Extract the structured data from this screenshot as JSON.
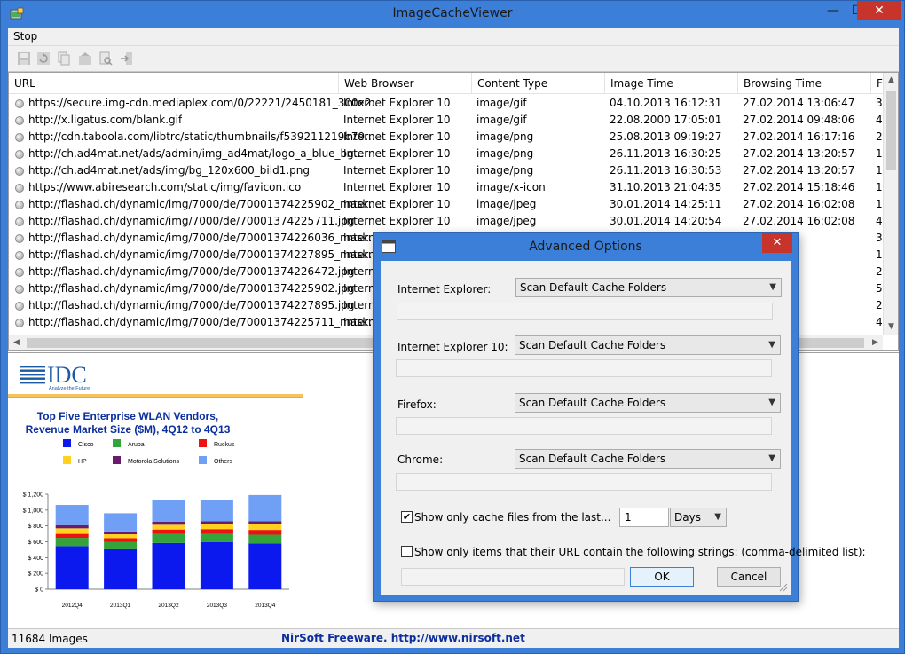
{
  "window": {
    "title": "ImageCacheViewer",
    "minimize_glyph": "—",
    "maximize_glyph": "☐",
    "close_glyph": "✕"
  },
  "menu": {
    "items": [
      "Stop"
    ]
  },
  "toolbar": {
    "icons": [
      "save-icon",
      "refresh-icon",
      "copy-icon",
      "properties-icon",
      "find-icon",
      "exit-icon"
    ]
  },
  "table": {
    "columns": [
      "URL",
      "Web Browser",
      "Content Type",
      "Image Time",
      "Browsing Time",
      "Fi"
    ],
    "rows": [
      [
        "https://secure.img-cdn.mediaplex.com/0/22221/2450181_300x2...",
        "Internet Explorer 10",
        "image/gif",
        "04.10.2013 16:12:31",
        "27.02.2014 13:06:47",
        "36"
      ],
      [
        "http://x.ligatus.com/blank.gif",
        "Internet Explorer 10",
        "image/gif",
        "22.08.2000 17:05:01",
        "27.02.2014 09:48:06",
        "43"
      ],
      [
        "http://cdn.taboola.com/libtrc/static/thumbnails/f539211219b79...",
        "Internet Explorer 10",
        "image/png",
        "25.08.2013 09:19:27",
        "27.02.2014 16:17:16",
        "25"
      ],
      [
        "http://ch.ad4mat.net/ads/admin/img_ad4mat/logo_a_blue_bg....",
        "Internet Explorer 10",
        "image/png",
        "26.11.2013 16:30:25",
        "27.02.2014 13:20:57",
        "1,"
      ],
      [
        "http://ch.ad4mat.net/ads/img/bg_120x600_bild1.png",
        "Internet Explorer 10",
        "image/png",
        "26.11.2013 16:30:53",
        "27.02.2014 13:20:57",
        "1,"
      ],
      [
        "https://www.abiresearch.com/static/img/favicon.ico",
        "Internet Explorer 10",
        "image/x-icon",
        "31.10.2013 21:04:35",
        "27.02.2014 15:18:46",
        "1,"
      ],
      [
        "http://flashad.ch/dynamic/img/7000/de/70001374225902_mask....",
        "Internet Explorer 10",
        "image/jpeg",
        "30.01.2014 14:25:11",
        "27.02.2014 16:02:08",
        "1,"
      ],
      [
        "http://flashad.ch/dynamic/img/7000/de/70001374225711.jpg",
        "Internet Explorer 10",
        "image/jpeg",
        "30.01.2014 14:20:54",
        "27.02.2014 16:02:08",
        "4,"
      ],
      [
        "http://flashad.ch/dynamic/img/7000/de/70001374226036_mask....",
        "Interne",
        "",
        "",
        "16:02:08",
        "3,"
      ],
      [
        "http://flashad.ch/dynamic/img/7000/de/70001374227895_mask....",
        "Interne",
        "",
        "",
        "16:02:08",
        "1,"
      ],
      [
        "http://flashad.ch/dynamic/img/7000/de/70001374226472.jpg",
        "Interne",
        "",
        "",
        "16:02:08",
        "2,"
      ],
      [
        "http://flashad.ch/dynamic/img/7000/de/70001374225902.jpg",
        "Interne",
        "",
        "",
        "16:02:08",
        "5,"
      ],
      [
        "http://flashad.ch/dynamic/img/7000/de/70001374227895.jpg",
        "Interne",
        "",
        "",
        "16:02:08",
        "2,"
      ],
      [
        "http://flashad.ch/dynamic/img/7000/de/70001374225711_mask....",
        "Interne",
        "",
        "",
        "16:02:08",
        "4,"
      ]
    ]
  },
  "preview": {
    "logo_text": "IDC",
    "logo_tagline": "Analyze the Future",
    "chart_data": {
      "type": "bar",
      "stacked": true,
      "title": "Top Five Enterprise WLAN Vendors, Revenue Market Size ($M), 4Q12 to 4Q13",
      "title_lines": [
        "Top Five Enterprise WLAN Vendors,",
        "Revenue Market Size ($M), 4Q12 to 4Q13"
      ],
      "categories": [
        "2012Q4",
        "2013Q1",
        "2013Q2",
        "2013Q3",
        "2013Q4"
      ],
      "ylim": [
        0,
        1200
      ],
      "yticks": [
        "$ 0",
        "$ 200",
        "$ 400",
        "$ 600",
        "$ 800",
        "$ 1,000",
        "$ 1,200"
      ],
      "legend_placement": "top",
      "series": [
        {
          "name": "Cisco",
          "color": "#0b18ee",
          "values": [
            545,
            505,
            585,
            595,
            580
          ]
        },
        {
          "name": "Aruba",
          "color": "#33a33a",
          "values": [
            105,
            95,
            115,
            105,
            110
          ]
        },
        {
          "name": "Ruckus",
          "color": "#ee1111",
          "values": [
            50,
            45,
            55,
            60,
            60
          ]
        },
        {
          "name": "HP",
          "color": "#ffd21f",
          "values": [
            70,
            50,
            60,
            60,
            70
          ]
        },
        {
          "name": "Motorola Solutions",
          "color": "#6a1b6e",
          "values": [
            40,
            35,
            40,
            40,
            40
          ]
        },
        {
          "name": "Others",
          "color": "#6fa0f5",
          "values": [
            255,
            230,
            270,
            270,
            330
          ]
        }
      ]
    }
  },
  "status": {
    "count_text": "11684 Images",
    "link_text": "NirSoft Freeware.  http://www.nirsoft.net"
  },
  "dialog": {
    "title": "Advanced Options",
    "close_glyph": "✕",
    "ie_label": "Internet Explorer:",
    "ie_value": "Scan Default Cache Folders",
    "ie10_label": "Internet Explorer 10:",
    "ie10_value": "Scan Default Cache Folders",
    "firefox_label": "Firefox:",
    "firefox_value": "Scan Default Cache Folders",
    "chrome_label": "Chrome:",
    "chrome_value": "Scan Default Cache Folders",
    "last_checkbox_label": "Show only cache files from the last...",
    "last_checked": true,
    "last_value": "1",
    "last_unit": "Days",
    "url_checkbox_label": "Show only items that their URL contain the following strings: (comma-delimited list):",
    "url_checked": false,
    "url_value": "",
    "ok_label": "OK",
    "cancel_label": "Cancel"
  }
}
